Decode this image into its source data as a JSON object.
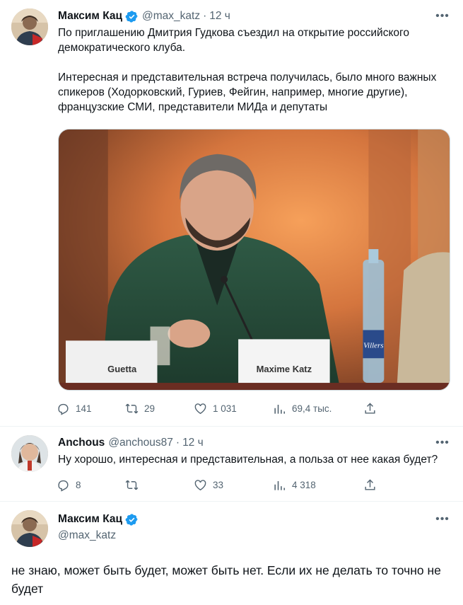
{
  "tweet1": {
    "name": "Максим Кац",
    "handle": "@max_katz",
    "time": "12 ч",
    "text_p1": "По приглашению Дмитрия Гудкова съездил на открытие российского демократического клуба.",
    "text_p2": "Интересная и представительная встреча получилась, было много важных спикеров (Ходорковский, Гуриев, Фейгин, например, многие другие), французские СМИ, представители МИДа и депутаты",
    "photo": {
      "nameplate_left": "Guetta",
      "nameplate_center": "Maxime Katz",
      "bottle_label": "Villers"
    },
    "stats": {
      "replies": "141",
      "reposts": "29",
      "likes": "1 031",
      "views": "69,4 тыс."
    }
  },
  "tweet2": {
    "name": "Anchous",
    "handle": "@anchous87",
    "time": "12 ч",
    "text": "Ну хорошо, интересная и представительная, а польза от нее какая будет?",
    "stats": {
      "replies": "8",
      "reposts": "",
      "likes": "33",
      "views": "4 318"
    }
  },
  "tweet3": {
    "name": "Максим Кац",
    "handle": "@max_katz",
    "text": "не знаю, может быть будет, может быть нет. Если их не делать то точно не будет"
  },
  "colors": {
    "verified": "#1d9bf0",
    "secondary_text": "#536471",
    "divider": "#eff3f4"
  },
  "icons": [
    "verified-badge-icon",
    "more-icon",
    "reply-icon",
    "repost-icon",
    "like-icon",
    "views-icon",
    "share-icon"
  ]
}
